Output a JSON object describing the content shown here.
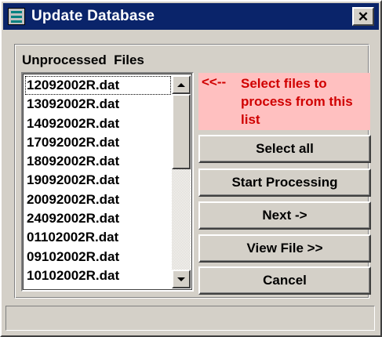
{
  "window": {
    "title": "Update Database",
    "close_glyph": "✕",
    "title_bar_color": "#0a246a",
    "app_icon": "database-icon"
  },
  "file_group": {
    "label": "Unprocessed  Files",
    "files": [
      "12092002R.dat",
      "13092002R.dat",
      "14092002R.dat",
      "17092002R.dat",
      "18092002R.dat",
      "19092002R.dat",
      "20092002R.dat",
      "24092002R.dat",
      "01102002R.dat",
      "09102002R.dat",
      "10102002R.dat"
    ],
    "focused_index": 0
  },
  "hint": {
    "arrow": "<<--",
    "text": "Select files to process from this list",
    "background": "#ffc0c0",
    "color": "#d00000"
  },
  "buttons": {
    "select_all": "Select all",
    "start_processing": "Start Processing",
    "next": "Next ->",
    "view_file": "View File >>",
    "cancel": "Cancel"
  },
  "status": {
    "text": ""
  }
}
